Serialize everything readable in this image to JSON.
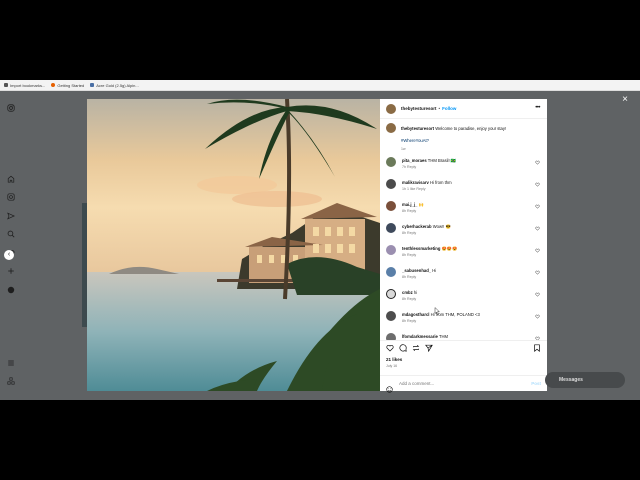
{
  "bookmarks": [
    {
      "label": "Import bookmarks...",
      "color": "#555555"
    },
    {
      "label": "Getting Started",
      "color": "#e66000"
    },
    {
      "label": "Acre Gold (2.5g) Alpin...",
      "color": "#4a6fa5"
    }
  ],
  "post": {
    "username": "thebytesturesort",
    "separator": "•",
    "follow_label": "Follow",
    "more_label": "•••",
    "caption_user": "thebytesturesort",
    "caption_text": "Welcome to paradise, enjoy your stay!",
    "caption_hashtag": "#WhereYouAt?",
    "caption_time": "1w",
    "likes": "21 likes",
    "date": "July 16"
  },
  "comments": [
    {
      "user": "pita_moraes",
      "text": "THM Brasil! 🇧🇷",
      "meta": "7h   Reply",
      "avatar_color": "#6b7a5a"
    },
    {
      "user": "malikravisarv",
      "text": "Hi from thm",
      "meta": "1h   1 like   Reply",
      "avatar_color": "#4b4b4b"
    },
    {
      "user": "mai.j_j_",
      "text": "🙌",
      "meta": "8h   Reply",
      "avatar_color": "#7a4f3a"
    },
    {
      "user": "cyberhackerab",
      "text": "Wow!! 😎",
      "meta": "8h   Reply",
      "avatar_color": "#3f4a5c"
    },
    {
      "user": "tenthlessmarketing",
      "text": "😍😍😍",
      "meta": "8h   Reply",
      "avatar_color": "#9b8fb0"
    },
    {
      "user": "_sabusenhad_",
      "text": "Hi",
      "meta": "8h   Reply",
      "avatar_color": "#5a7fa8"
    },
    {
      "user": "cmbz",
      "text": "hi",
      "meta": "8h   Reply",
      "avatar_color": "#d9d9d9"
    },
    {
      "user": "mdagostharcl",
      "text": "Hi from THM, POLAND <3",
      "meta": "8h   Reply",
      "avatar_color": "#4d4d4d"
    },
    {
      "user": "lfomdarkmessarie",
      "text": "THM",
      "meta": "",
      "avatar_color": "#6d6d6d"
    }
  ],
  "add_comment": {
    "placeholder": "Add a comment...",
    "post_label": "Post"
  },
  "messages": {
    "label": "Messages"
  },
  "colors": {
    "link": "#0095f6",
    "page_bg": "#5f6264"
  },
  "icons": [
    "instagram-icon",
    "home-icon",
    "search-icon",
    "explore-icon",
    "reels-icon",
    "messenger-icon",
    "heart-icon",
    "create-icon",
    "profile-icon",
    "menu-icon",
    "threads-icon",
    "comment-icon",
    "share-icon",
    "bookmark-icon",
    "emoji-icon",
    "close-icon",
    "chevron-left-icon"
  ]
}
